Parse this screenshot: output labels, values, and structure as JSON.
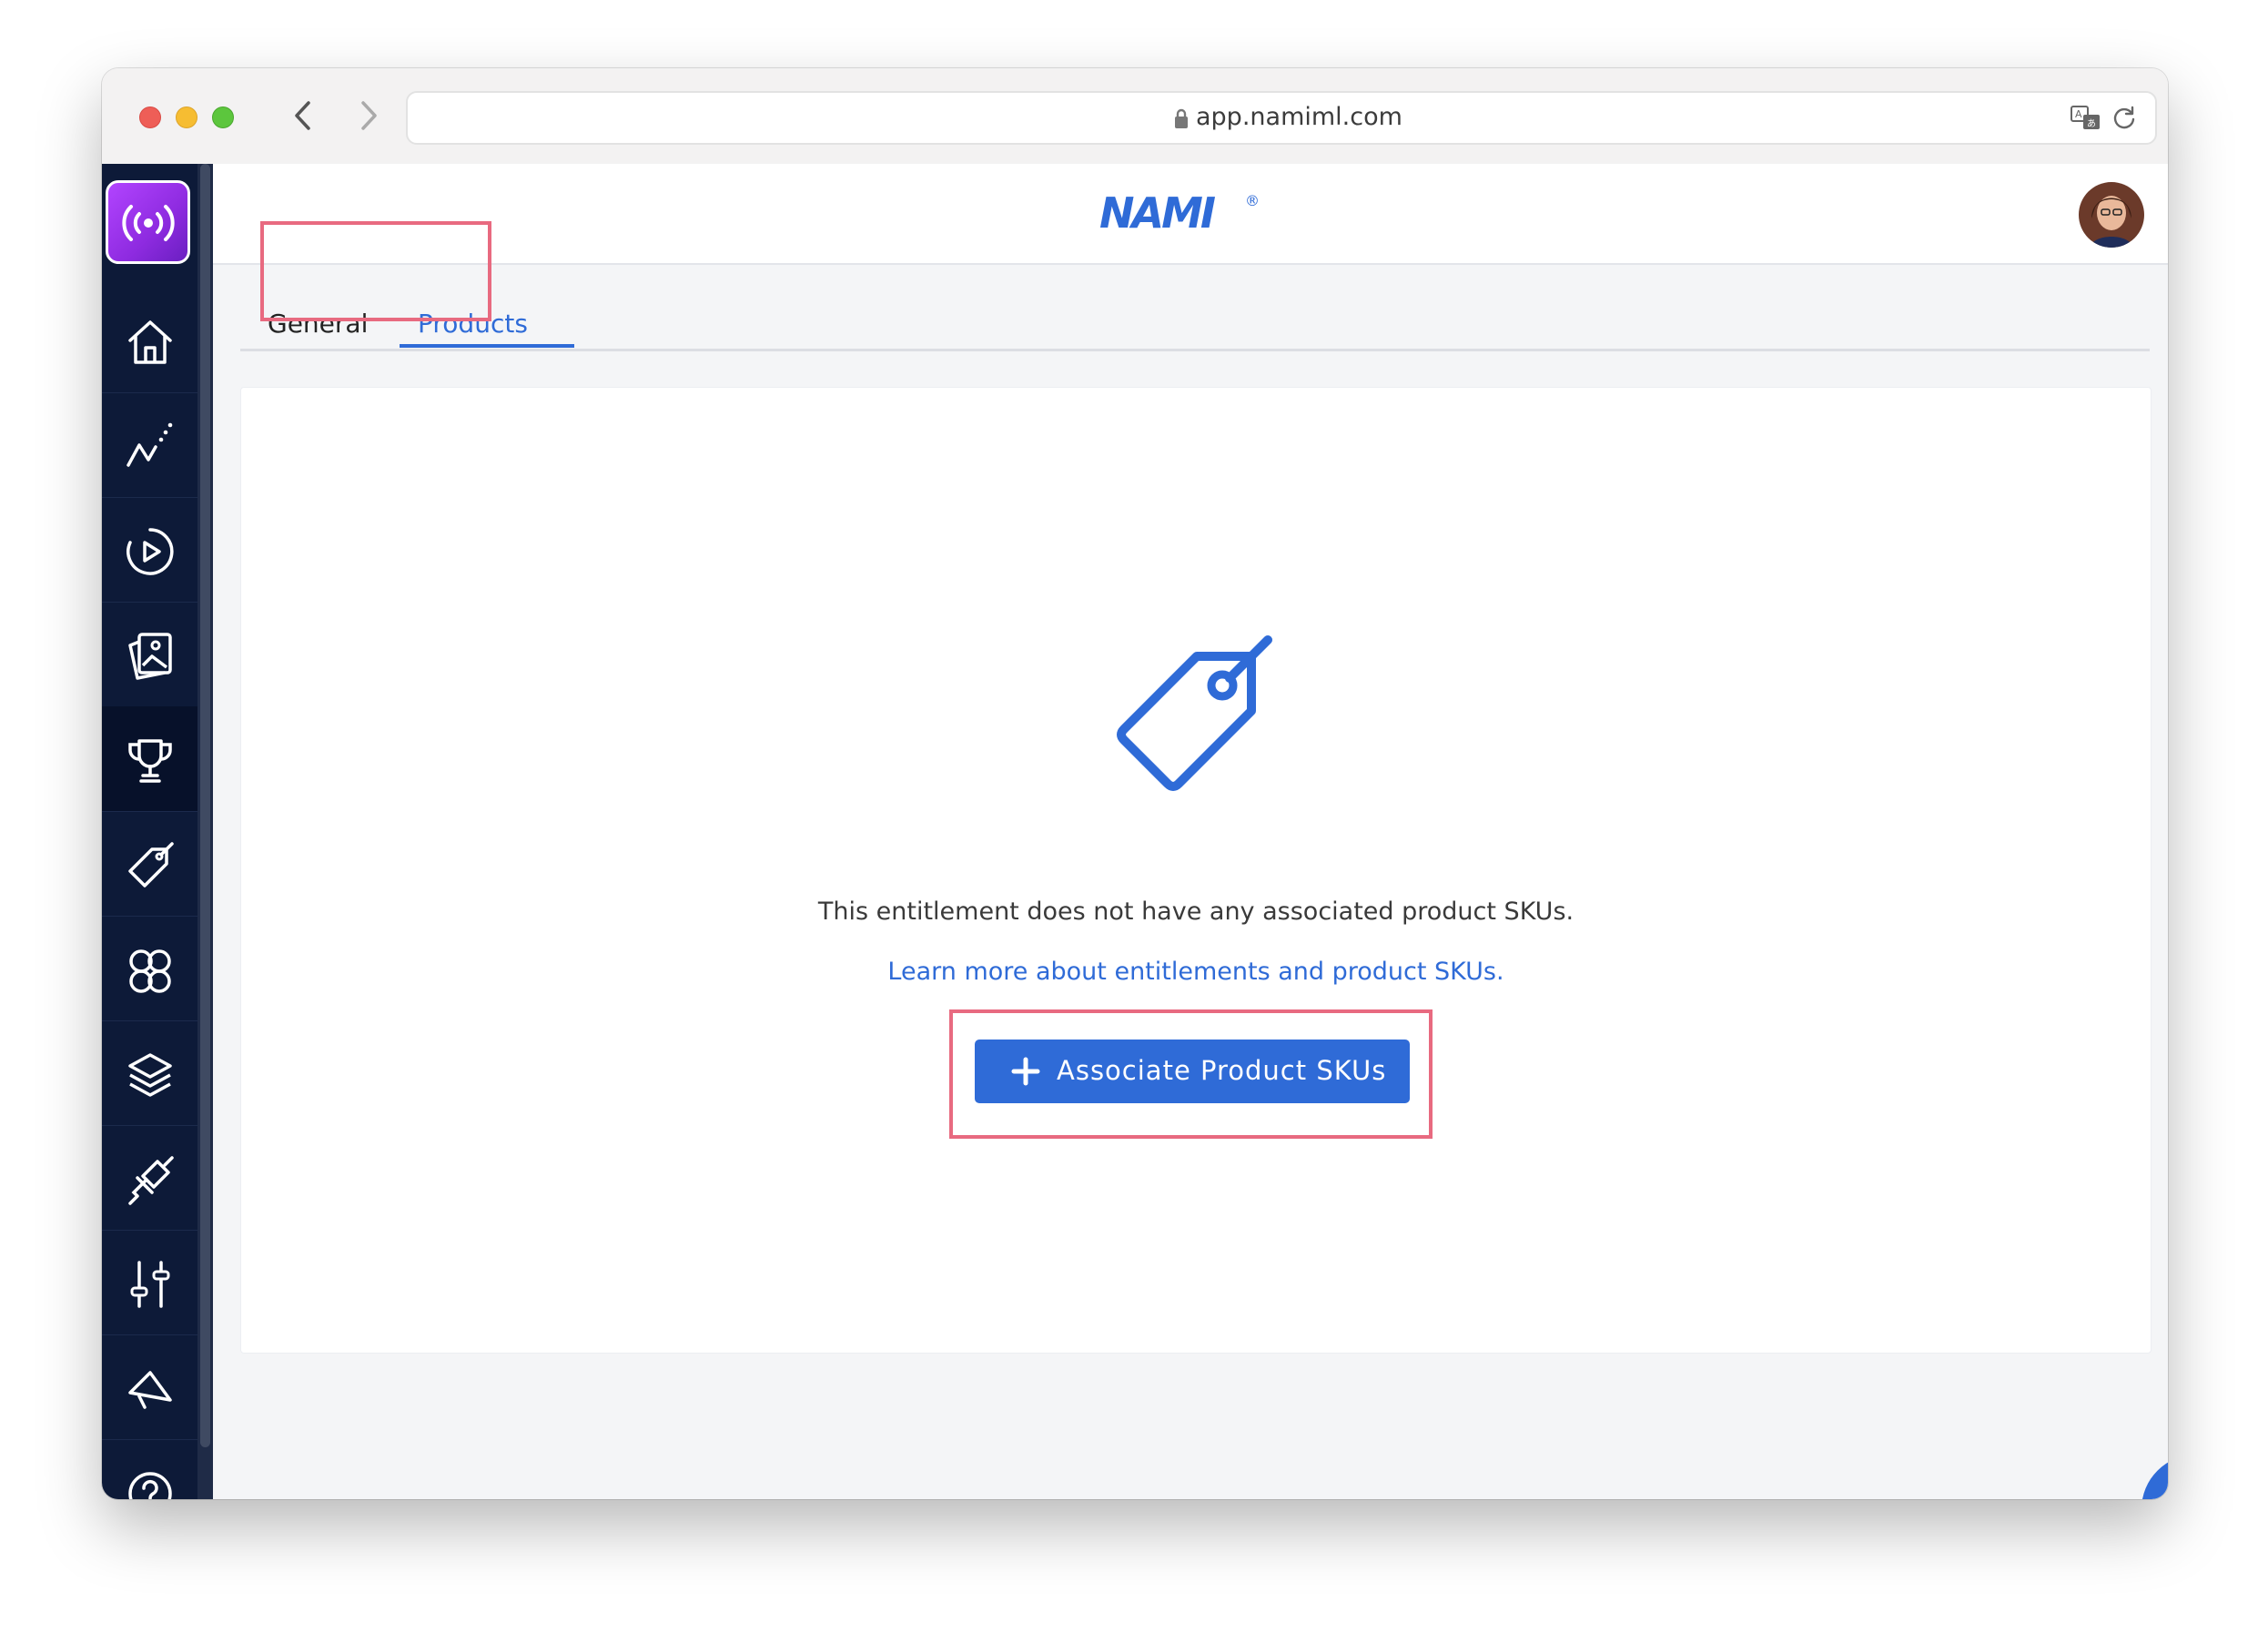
{
  "browser": {
    "url": "app.namiml.com"
  },
  "brand": {
    "logo_text": "NAMI",
    "registered": "®"
  },
  "sidebar": {
    "items": [
      {
        "name": "home",
        "icon": "home-icon"
      },
      {
        "name": "analytics",
        "icon": "chart-line-icon"
      },
      {
        "name": "campaigns",
        "icon": "play-circle-icon"
      },
      {
        "name": "paywalls",
        "icon": "images-icon"
      },
      {
        "name": "entitlements",
        "icon": "trophy-icon",
        "active": true
      },
      {
        "name": "products",
        "icon": "tag-icon"
      },
      {
        "name": "audiences",
        "icon": "users-icon"
      },
      {
        "name": "integrations-stack",
        "icon": "layers-icon"
      },
      {
        "name": "integrations",
        "icon": "plug-icon"
      },
      {
        "name": "settings",
        "icon": "sliders-icon"
      },
      {
        "name": "announcements",
        "icon": "megaphone-icon"
      },
      {
        "name": "help",
        "icon": "help-icon"
      }
    ]
  },
  "tabs": [
    {
      "label": "General",
      "active": false
    },
    {
      "label": "Products",
      "active": true
    }
  ],
  "empty_state": {
    "message": "This entitlement does not have any associated product SKUs.",
    "link": "Learn more about entitlements and product SKUs.",
    "button": "Associate Product SKUs"
  },
  "colors": {
    "accent": "#2f6bd7",
    "sidebar": "#0d1a38",
    "highlight": "#e86a80"
  }
}
